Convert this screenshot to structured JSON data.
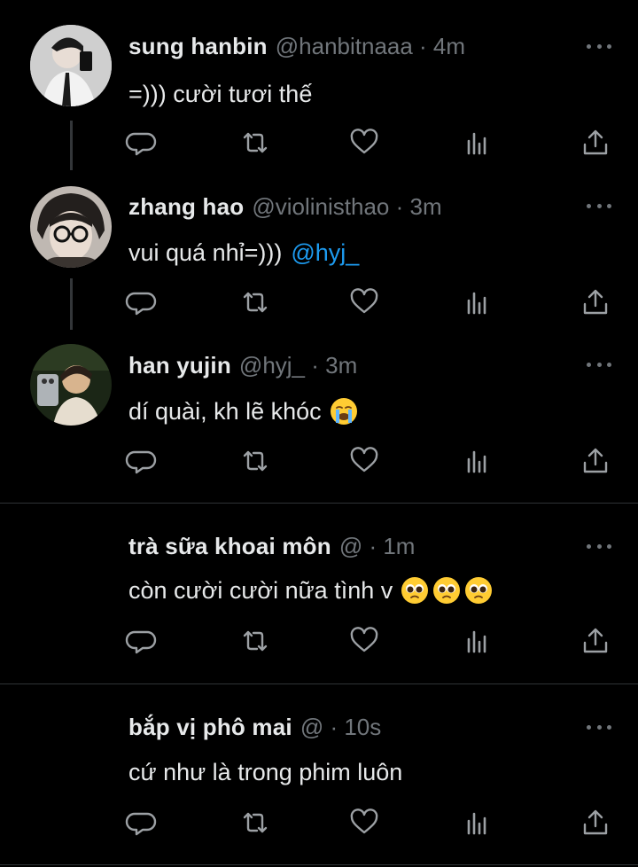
{
  "tweets": [
    {
      "name": "sung hanbin",
      "meta": "@hanbitnaaa · 4m",
      "text": "=))) cười tươi thế",
      "avatar_icon": "selfie-avatar",
      "avatar_colors": [
        "#dcdcdc",
        "#1a1a1a"
      ]
    },
    {
      "name": "zhang hao",
      "meta": "@violinisthao · 3m",
      "text": "vui quá nhỉ=)))",
      "mention": "@hyj_",
      "avatar_icon": "glasses-avatar",
      "avatar_colors": [
        "#c8c2bd",
        "#2a2624"
      ]
    },
    {
      "name": "han yujin",
      "meta": "@hyj_ · 3m",
      "text": "dí quài, kh lẽ khóc",
      "emoji": "loudly-crying-face",
      "avatar_icon": "mirror-selfie-avatar",
      "avatar_colors": [
        "#1e2a18",
        "#d9b38c"
      ]
    },
    {
      "name": "trà sữa khoai môn",
      "meta": "@ · 1m",
      "text": "còn cười cười nữa tình v",
      "emoji": "pleading-face",
      "emoji_count": 3
    },
    {
      "name": "bắp vị phô mai",
      "meta": "@ · 10s",
      "text": "cứ như là trong phim luôn"
    }
  ],
  "action_icons": [
    "reply-icon",
    "retweet-icon",
    "like-icon",
    "views-icon",
    "share-icon"
  ],
  "colors": {
    "background": "#000000",
    "text": "#e7e9ea",
    "muted": "#71767b",
    "link": "#1d9bf0",
    "divider": "#2f3336"
  }
}
